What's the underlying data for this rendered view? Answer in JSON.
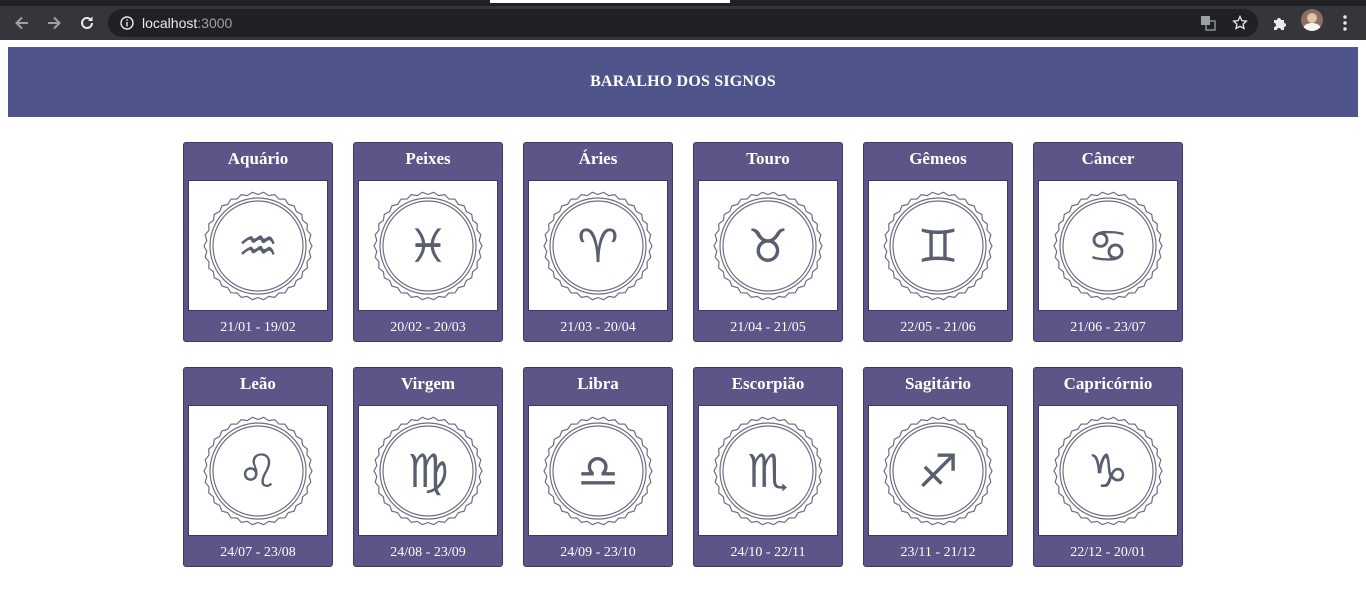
{
  "browser": {
    "url_host": "localhost",
    "url_port": ":3000",
    "icons": {
      "back": "back-arrow-icon",
      "forward": "forward-arrow-icon",
      "reload": "reload-icon",
      "info": "site-info-icon",
      "translate": "translate-icon",
      "bookmark": "star-icon",
      "extensions": "puzzle-icon",
      "menu": "kebab-menu-icon"
    }
  },
  "page": {
    "title": "BARALHO DOS SIGNOS",
    "colors": {
      "header_bg": "#4f548b",
      "card_bg": "#5b5588",
      "card_border": "#3e3868"
    }
  },
  "signs": [
    {
      "name": "Aquário",
      "dates": "21/01 - 19/02",
      "icon": "aquarius-icon",
      "glyph": "♒"
    },
    {
      "name": "Peixes",
      "dates": "20/02 - 20/03",
      "icon": "pisces-icon",
      "glyph": "♓"
    },
    {
      "name": "Áries",
      "dates": "21/03 - 20/04",
      "icon": "aries-icon",
      "glyph": "♈"
    },
    {
      "name": "Touro",
      "dates": "21/04 - 21/05",
      "icon": "taurus-icon",
      "glyph": "♉"
    },
    {
      "name": "Gêmeos",
      "dates": "22/05 - 21/06",
      "icon": "gemini-icon",
      "glyph": "♊"
    },
    {
      "name": "Câncer",
      "dates": "21/06 - 23/07",
      "icon": "cancer-icon",
      "glyph": "♋"
    },
    {
      "name": "Leão",
      "dates": "24/07 - 23/08",
      "icon": "leo-icon",
      "glyph": "♌"
    },
    {
      "name": "Virgem",
      "dates": "24/08 - 23/09",
      "icon": "virgo-icon",
      "glyph": "♍"
    },
    {
      "name": "Libra",
      "dates": "24/09 - 23/10",
      "icon": "libra-icon",
      "glyph": "♎"
    },
    {
      "name": "Escorpião",
      "dates": "24/10 - 22/11",
      "icon": "scorpio-icon",
      "glyph": "♏"
    },
    {
      "name": "Sagitário",
      "dates": "23/11 - 21/12",
      "icon": "sagittarius-icon",
      "glyph": "♐"
    },
    {
      "name": "Capricórnio",
      "dates": "22/12 - 20/01",
      "icon": "capricorn-icon",
      "glyph": "♑"
    }
  ]
}
